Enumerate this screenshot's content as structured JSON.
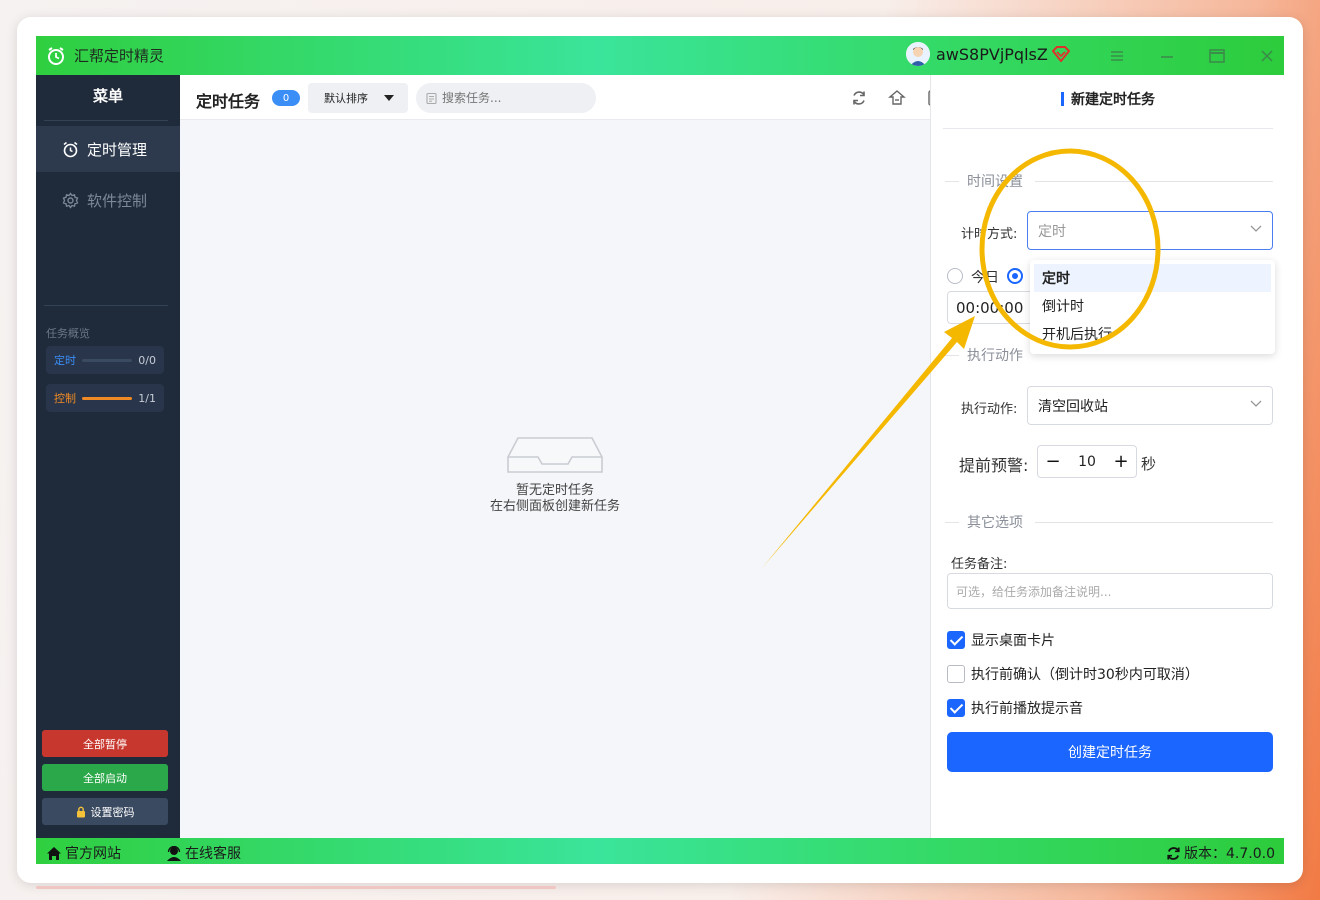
{
  "app": {
    "title": "汇帮定时精灵",
    "username": "awS8PVjPqlsZ"
  },
  "sidebar": {
    "menu_title": "菜单",
    "items": [
      {
        "label": "定时管理",
        "active": true
      },
      {
        "label": "软件控制",
        "active": false
      }
    ],
    "overview_label": "任务概览",
    "overview": [
      {
        "label": "定时",
        "count": "0/0",
        "progress": 0,
        "color": "#3a8ef5"
      },
      {
        "label": "控制",
        "count": "1/1",
        "progress": 1,
        "color": "#f08a24"
      }
    ],
    "buttons": {
      "pause_all": "全部暂停",
      "start_all": "全部启动",
      "set_password": "设置密码"
    }
  },
  "toolbar": {
    "title": "定时任务",
    "count": "0",
    "sort_label": "默认排序",
    "search_placeholder": "搜索任务..."
  },
  "empty_state": {
    "line1": "暂无定时任务",
    "line2": "在右侧面板创建新任务"
  },
  "panel": {
    "title": "新建定时任务",
    "time_section": "时间设置",
    "timing_mode_label": "计时方式:",
    "timing_mode_value": "定时",
    "timing_mode_options": [
      "定时",
      "倒计时",
      "开机后执行"
    ],
    "radio_today": "今日",
    "time_value": "00:00:00",
    "action_section": "执行动作",
    "action_label": "执行动作:",
    "action_value": "清空回收站",
    "warn_label": "提前预警:",
    "warn_value": "10",
    "warn_unit": "秒",
    "other_section": "其它选项",
    "note_label": "任务备注:",
    "note_placeholder": "可选，给任务添加备注说明...",
    "checks": [
      {
        "label": "显示桌面卡片",
        "checked": true
      },
      {
        "label": "执行前确认（倒计时30秒内可取消）",
        "checked": false
      },
      {
        "label": "执行前播放提示音",
        "checked": true
      }
    ],
    "create_button": "创建定时任务"
  },
  "statusbar": {
    "website": "官方网站",
    "support": "在线客服",
    "version": "版本：4.7.0.0"
  },
  "colors": {
    "accent": "#1a66ff",
    "titlebar_green": "#35db6a",
    "sidebar_bg": "#1f2a3a",
    "pause_red": "#c8372d",
    "start_green": "#2aa84a",
    "annotation": "#f5b800"
  }
}
